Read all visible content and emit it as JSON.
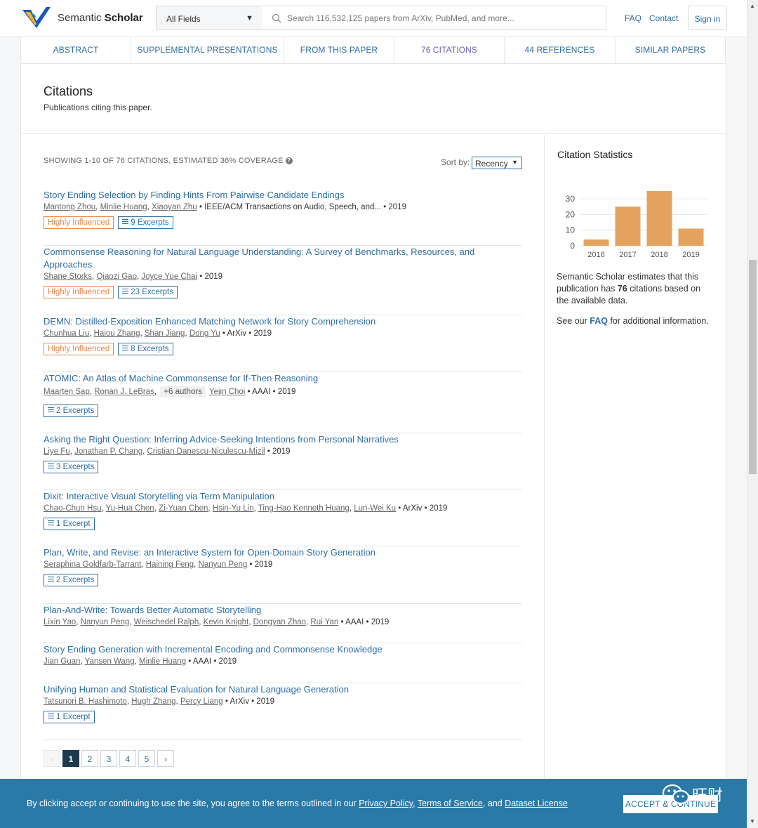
{
  "header": {
    "brand_light": "Semantic ",
    "brand_bold": "Scholar",
    "fields_label": "All Fields",
    "search_placeholder": "Search 116,532,125 papers from ArXiv, PubMed, and more...",
    "faq": "FAQ",
    "contact": "Contact",
    "signin": "Sign in"
  },
  "tabs": [
    {
      "label": "ABSTRACT"
    },
    {
      "label": "SUPPLEMENTAL PRESENTATIONS"
    },
    {
      "label": "FROM THIS PAPER"
    },
    {
      "label": "76 CITATIONS"
    },
    {
      "label": "44 REFERENCES"
    },
    {
      "label": "SIMILAR PAPERS"
    }
  ],
  "citations": {
    "title": "Citations",
    "subtitle": "Publications citing this paper.",
    "showing": "SHOWING 1-10 OF 76 CITATIONS, ESTIMATED 36% COVERAGE",
    "sort_label": "Sort by:",
    "sort_value": "Recency"
  },
  "papers": [
    {
      "title": "Story Ending Selection by Finding Hints From Pairwise Candidate Endings",
      "authors": [
        "Mantong Zhou",
        "Minlie Huang",
        "Xiaoyan Zhu"
      ],
      "venue": "IEEE/ACM Transactions on Audio, Speech, and...",
      "year": "2019",
      "influenced": "Highly Influenced",
      "excerpts": "9 Excerpts"
    },
    {
      "title": "Commonsense Reasoning for Natural Language Understanding: A Survey of Benchmarks, Resources, and Approaches",
      "authors": [
        "Shane Storks",
        "Qiaozi Gao",
        "Joyce Yue Chai"
      ],
      "venue": "",
      "year": "2019",
      "influenced": "Highly Influenced",
      "excerpts": "23 Excerpts"
    },
    {
      "title": "DEMN: Distilled-Exposition Enhanced Matching Network for Story Comprehension",
      "authors": [
        "Chunhua Liu",
        "Haiou Zhang",
        "Shan Jiang",
        "Dong Yu"
      ],
      "venue": "ArXiv",
      "year": "2019",
      "influenced": "Highly Influenced",
      "excerpts": "8 Excerpts"
    },
    {
      "title": "ATOMIC: An Atlas of Machine Commonsense for If-Then Reasoning",
      "authors": [
        "Maarten Sap",
        "Ronan J. LeBras"
      ],
      "more": "+6 authors",
      "authors2": [
        "Yejin Choi"
      ],
      "venue": "AAAI",
      "year": "2019",
      "influenced": "",
      "excerpts": "2 Excerpts"
    },
    {
      "title": "Asking the Right Question: Inferring Advice-Seeking Intentions from Personal Narratives",
      "authors": [
        "Liye Fu",
        "Jonathan P. Chang",
        "Cristian Danescu-Niculescu-Mizil"
      ],
      "venue": "",
      "year": "2019",
      "influenced": "",
      "excerpts": "3 Excerpts"
    },
    {
      "title": "Dixit: Interactive Visual Storytelling via Term Manipulation",
      "authors": [
        "Chao-Chun Hsu",
        "Yu-Hua Chen",
        "Zi-Yuan Chen",
        "Hsin-Yu Lin",
        "Ting-Hao Kenneth Huang",
        "Lun-Wei Ku"
      ],
      "venue": "ArXiv",
      "year": "2019",
      "influenced": "",
      "excerpts": "1 Excerpt"
    },
    {
      "title": "Plan, Write, and Revise: an Interactive System for Open-Domain Story Generation",
      "authors": [
        "Seraphina Goldfarb-Tarrant",
        "Haining Feng",
        "Nanyun Peng"
      ],
      "venue": "",
      "year": "2019",
      "influenced": "",
      "excerpts": "2 Excerpts"
    },
    {
      "title": "Plan-And-Write: Towards Better Automatic Storytelling",
      "authors": [
        "Lixin Yao",
        "Nanyun Peng",
        "Weischedel Ralph",
        "Kevin Knight",
        "Dongyan Zhao",
        "Rui Yan"
      ],
      "venue": "AAAI",
      "year": "2019",
      "influenced": "",
      "excerpts": ""
    },
    {
      "title": "Story Ending Generation with Incremental Encoding and Commonsense Knowledge",
      "authors": [
        "Jian Guan",
        "Yansen Wang",
        "Minlie Huang"
      ],
      "venue": "AAAI",
      "year": "2019",
      "influenced": "",
      "excerpts": ""
    },
    {
      "title": "Unifying Human and Statistical Evaluation for Natural Language Generation",
      "authors": [
        "Tatsunori B. Hashimoto",
        "Hugh Zhang",
        "Percy Liang"
      ],
      "venue": "ArXiv",
      "year": "2019",
      "influenced": "",
      "excerpts": "1 Excerpt"
    }
  ],
  "pager": {
    "prev": "‹",
    "pages": [
      "1",
      "2",
      "3",
      "4",
      "5"
    ],
    "next": "›",
    "current": "1"
  },
  "stats": {
    "title": "Citation Statistics",
    "desc_pre": "Semantic Scholar estimates that this publication has ",
    "desc_count": "76",
    "desc_post": " citations based on the available data.",
    "faq_pre": "See our ",
    "faq_link": "FAQ",
    "faq_post": " for additional information."
  },
  "chart_data": {
    "type": "bar",
    "categories": [
      "2016",
      "2017",
      "2018",
      "2019"
    ],
    "values": [
      4,
      25,
      35,
      11
    ],
    "ylim": [
      0,
      35
    ],
    "yticks": [
      0,
      10,
      20,
      30
    ],
    "grid": true,
    "bar_color": "#e3a35f",
    "title": "",
    "xlabel": "",
    "ylabel": ""
  },
  "cookie": {
    "pre": "By clicking accept or continuing to use the site, you agree to the terms outlined in our ",
    "privacy": "Privacy Policy",
    "sep1": ", ",
    "tos": "Terms of Service",
    "sep2": ", and ",
    "dataset": "Dataset License",
    "accept": "ACCEPT & CONTINUE"
  },
  "watermark": "旺财",
  "colors": {
    "link": "#2e6da4",
    "influenced": "#e8864b",
    "banner": "#2a79a6",
    "active_tab": "#6a5fb0"
  }
}
